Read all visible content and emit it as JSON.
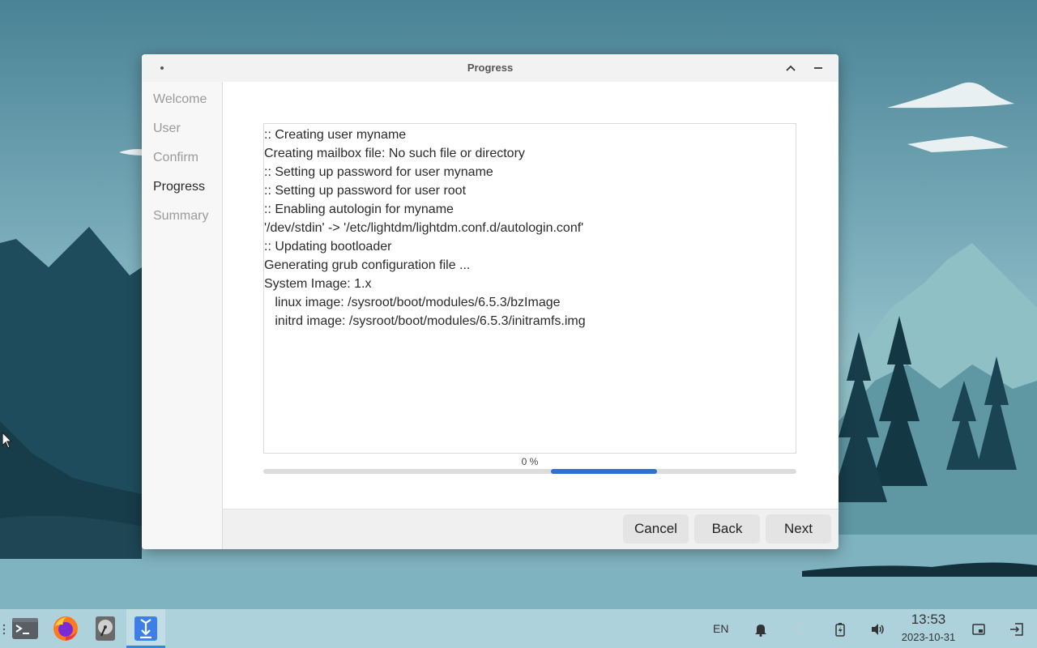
{
  "window": {
    "title": "Progress"
  },
  "sidebar": {
    "steps": [
      {
        "label": "Welcome",
        "active": false
      },
      {
        "label": "User",
        "active": false
      },
      {
        "label": "Confirm",
        "active": false
      },
      {
        "label": "Progress",
        "active": true
      },
      {
        "label": "Summary",
        "active": false
      }
    ]
  },
  "log": {
    "lines": [
      ":: Creating user myname",
      "Creating mailbox file: No such file or directory",
      ":: Setting up password for user myname",
      ":: Setting up password for user root",
      ":: Enabling autologin for myname",
      "'/dev/stdin' -> '/etc/lightdm/lightdm.conf.d/autologin.conf'",
      ":: Updating bootloader",
      "Generating grub configuration file ...",
      "System Image: 1.x",
      "   linux image: /sysroot/boot/modules/6.5.3/bzImage",
      "   initrd image: /sysroot/boot/modules/6.5.3/initramfs.img"
    ]
  },
  "progress": {
    "percent_label": "0 %",
    "state": "indeterminate",
    "accent_color": "#2f6fd6"
  },
  "footer": {
    "cancel_label": "Cancel",
    "back_label": "Back",
    "next_label": "Next"
  },
  "taskbar": {
    "apps": [
      {
        "name": "terminal-icon",
        "active": false
      },
      {
        "name": "firefox-icon",
        "active": false
      },
      {
        "name": "disk-utility-icon",
        "active": false
      },
      {
        "name": "installer-icon",
        "active": true
      }
    ],
    "language": "EN",
    "clock_time": "13:53",
    "clock_date": "2023-10-31"
  }
}
